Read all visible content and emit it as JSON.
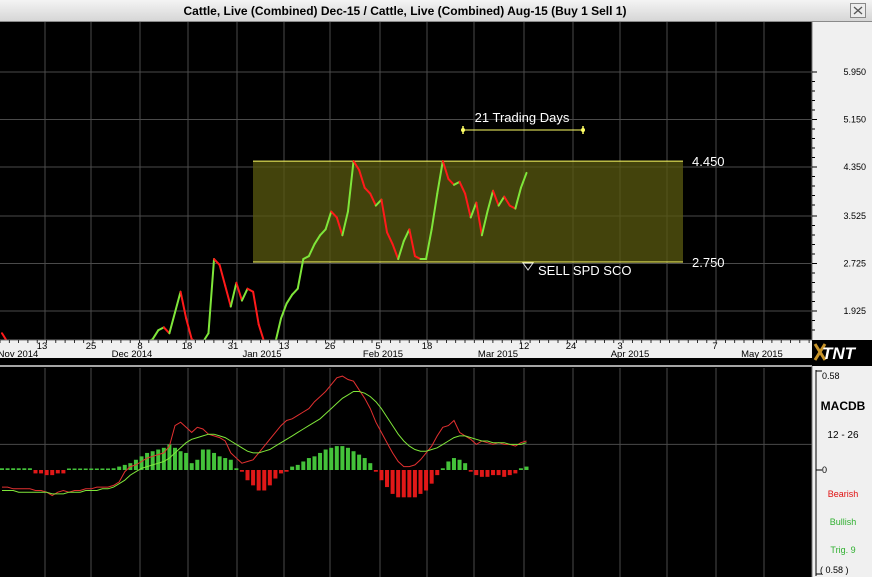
{
  "window": {
    "title": "Cattle, Live (Combined) Dec-15  / Cattle, Live (Combined) Aug-15 (Buy 1 Sell 1)"
  },
  "logo": "TNT",
  "colors": {
    "background": "#000000",
    "up": "#7fe63a",
    "down": "#ff1a1a",
    "range_box": "#ffff66",
    "grid": "#4a4a4a"
  },
  "chart_data": [
    {
      "type": "line",
      "title": "Cattle, Live (Combined) Dec-15  / Cattle, Live (Combined) Aug-15 (Buy 1 Sell 1)",
      "ylim": [
        1.4,
        6.5
      ],
      "y_ticks": [
        "5.950",
        "5.150",
        "4.350",
        "3.525",
        "2.725",
        "1.925"
      ],
      "y_tick_values": [
        5.95,
        5.15,
        4.35,
        3.525,
        2.725,
        1.925
      ],
      "x_tick_labels": [
        "Nov 2014",
        "13",
        "25",
        "Dec 2014",
        "8",
        "18",
        "31",
        "Jan 2015",
        "13",
        "26",
        "5",
        "Feb 2015",
        "18",
        "Mar 2015",
        "12",
        "24",
        "3",
        "Apr 2015",
        "7",
        "May 2015"
      ],
      "series": [
        {
          "values": [
            1.55,
            1.4,
            1.4,
            1.4,
            1.4,
            1.4,
            1.4,
            1.4,
            1.4,
            1.4,
            1.4,
            1.4,
            1.4,
            1.4,
            1.4,
            1.4,
            1.4,
            1.4,
            1.4,
            1.4,
            1.4,
            1.4,
            1.4,
            1.4,
            1.4,
            1.4,
            1.4,
            1.45,
            1.6,
            1.65,
            1.55,
            1.9,
            2.25,
            1.8,
            1.45,
            1.4,
            1.4,
            1.55,
            2.8,
            2.7,
            2.35,
            2.0,
            2.4,
            2.1,
            2.3,
            2.25,
            1.7,
            1.4,
            1.4,
            1.4,
            1.8,
            2.05,
            2.2,
            2.3,
            2.8,
            2.85,
            3.05,
            3.2,
            3.3,
            3.6,
            3.5,
            3.2,
            3.6,
            4.45,
            4.3,
            4.0,
            3.9,
            3.7,
            3.8,
            3.25,
            3.05,
            2.8,
            3.1,
            3.3,
            2.85,
            2.8,
            2.8,
            3.3,
            3.9,
            4.45,
            4.15,
            4.05,
            4.1,
            3.9,
            3.5,
            3.75,
            3.2,
            3.6,
            3.95,
            3.7,
            3.85,
            3.7,
            3.65,
            4.0,
            4.25
          ]
        }
      ],
      "range_box": {
        "high": 4.45,
        "low": 2.75,
        "high_label": "4.450",
        "low_label": "2.750"
      },
      "annotations": {
        "trading_days": "21 Trading Days",
        "signal": "SELL SPD SCO"
      }
    },
    {
      "type": "bar",
      "title": "MACDB",
      "params": "12 - 26",
      "ylim": [
        -0.58,
        0.58
      ],
      "y_ticks": [
        "0.58",
        "0",
        "( 0.58 )"
      ],
      "legend": [
        "Bearish",
        "Bullish",
        "Trig. 9"
      ],
      "histogram": [
        0.01,
        0.01,
        0.01,
        0.01,
        0.01,
        0.01,
        -0.02,
        -0.02,
        -0.03,
        -0.03,
        -0.02,
        -0.02,
        0.005,
        0.005,
        0.005,
        0.005,
        0.005,
        0.005,
        0.005,
        0.005,
        0.01,
        0.02,
        0.03,
        0.04,
        0.06,
        0.08,
        0.1,
        0.11,
        0.12,
        0.13,
        0.15,
        0.13,
        0.11,
        0.1,
        0.04,
        0.06,
        0.12,
        0.12,
        0.1,
        0.08,
        0.07,
        0.06,
        0.01,
        -0.01,
        -0.06,
        -0.09,
        -0.12,
        -0.12,
        -0.09,
        -0.05,
        -0.02,
        -0.01,
        0.02,
        0.03,
        0.05,
        0.07,
        0.08,
        0.1,
        0.12,
        0.13,
        0.14,
        0.14,
        0.13,
        0.11,
        0.09,
        0.07,
        0.04,
        -0.01,
        -0.06,
        -0.1,
        -0.14,
        -0.16,
        -0.16,
        -0.16,
        -0.16,
        -0.14,
        -0.12,
        -0.08,
        -0.03,
        0.01,
        0.05,
        0.07,
        0.06,
        0.04,
        -0.01,
        -0.03,
        -0.04,
        -0.04,
        -0.03,
        -0.03,
        -0.04,
        -0.03,
        -0.02,
        0.01,
        0.02
      ],
      "macd": [
        -0.1,
        -0.1,
        -0.11,
        -0.11,
        -0.11,
        -0.11,
        -0.12,
        -0.12,
        -0.13,
        -0.15,
        -0.13,
        -0.12,
        -0.13,
        -0.12,
        -0.12,
        -0.11,
        -0.11,
        -0.1,
        -0.1,
        -0.1,
        -0.09,
        -0.07,
        -0.01,
        0.02,
        0.03,
        0.05,
        0.07,
        0.08,
        0.09,
        0.1,
        0.14,
        0.26,
        0.28,
        0.25,
        0.22,
        0.25,
        0.24,
        0.21,
        0.2,
        0.19,
        0.17,
        0.1,
        0.07,
        0.04,
        0.05,
        0.06,
        0.1,
        0.14,
        0.18,
        0.22,
        0.26,
        0.29,
        0.3,
        0.32,
        0.34,
        0.36,
        0.4,
        0.43,
        0.46,
        0.5,
        0.54,
        0.55,
        0.53,
        0.52,
        0.47,
        0.42,
        0.36,
        0.28,
        0.22,
        0.16,
        0.1,
        0.05,
        0.02,
        0.02,
        0.03,
        0.06,
        0.1,
        0.14,
        0.2,
        0.25,
        0.26,
        0.29,
        0.22,
        0.2,
        0.18,
        0.15,
        0.17,
        0.16,
        0.15,
        0.16,
        0.15,
        0.15,
        0.14,
        0.16,
        0.17
      ],
      "trigger": [
        -0.12,
        -0.12,
        -0.12,
        -0.13,
        -0.13,
        -0.13,
        -0.13,
        -0.13,
        -0.13,
        -0.14,
        -0.14,
        -0.14,
        -0.13,
        -0.13,
        -0.13,
        -0.12,
        -0.12,
        -0.12,
        -0.11,
        -0.11,
        -0.1,
        -0.08,
        -0.06,
        -0.03,
        -0.01,
        0.01,
        0.02,
        0.03,
        0.04,
        0.05,
        0.07,
        0.1,
        0.13,
        0.16,
        0.18,
        0.19,
        0.2,
        0.21,
        0.21,
        0.2,
        0.19,
        0.17,
        0.15,
        0.13,
        0.11,
        0.1,
        0.1,
        0.11,
        0.12,
        0.14,
        0.16,
        0.18,
        0.2,
        0.22,
        0.24,
        0.26,
        0.28,
        0.3,
        0.33,
        0.36,
        0.39,
        0.42,
        0.44,
        0.46,
        0.46,
        0.45,
        0.43,
        0.4,
        0.36,
        0.31,
        0.26,
        0.21,
        0.17,
        0.14,
        0.12,
        0.11,
        0.11,
        0.12,
        0.13,
        0.15,
        0.17,
        0.19,
        0.2,
        0.2,
        0.19,
        0.18,
        0.17,
        0.17,
        0.16,
        0.16,
        0.16,
        0.15,
        0.15,
        0.15,
        0.16
      ]
    }
  ]
}
